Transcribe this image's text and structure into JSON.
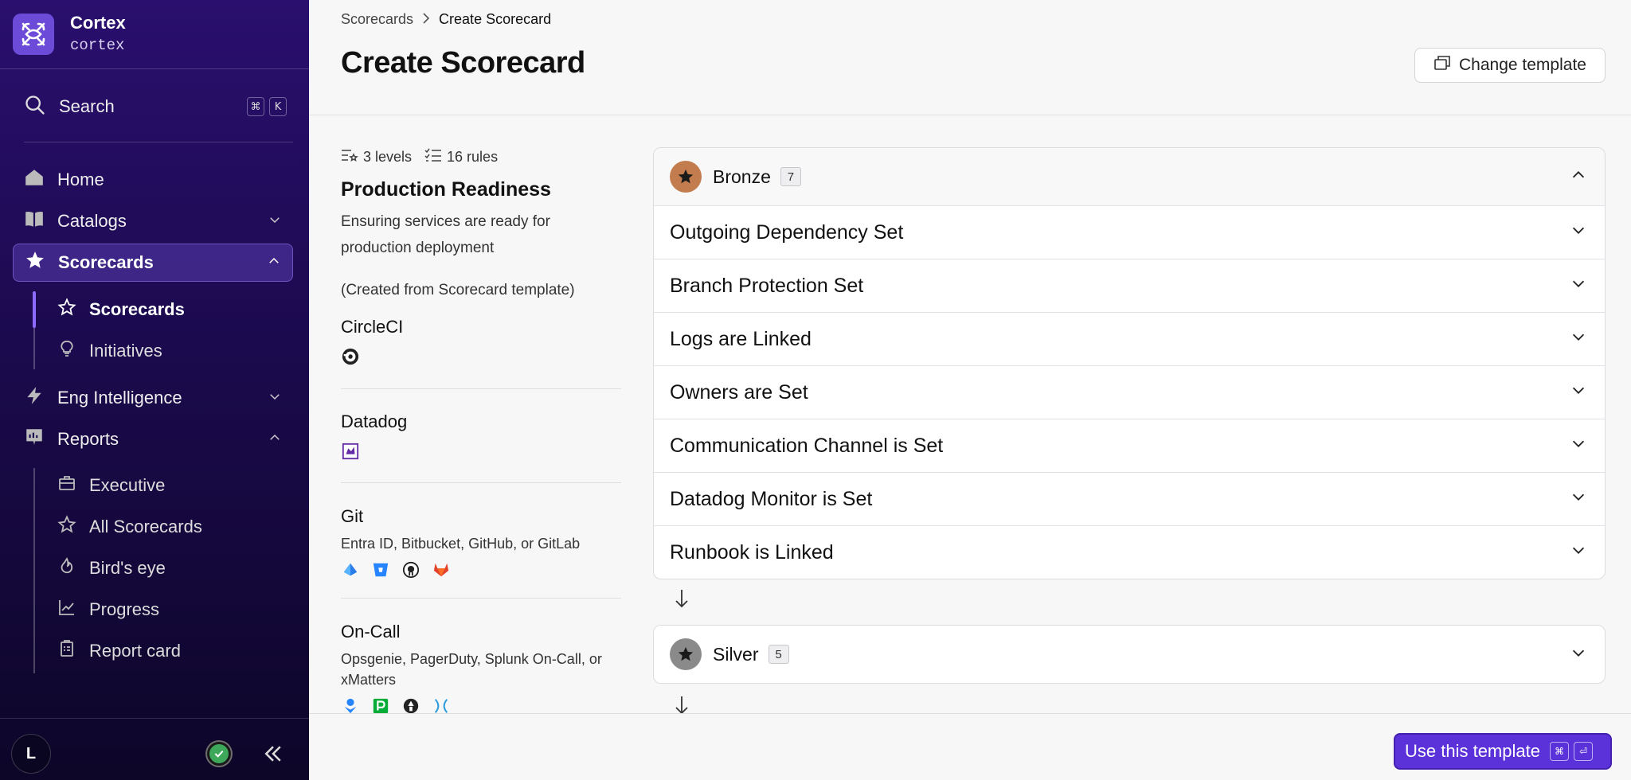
{
  "app": {
    "name": "Cortex",
    "workspace": "cortex"
  },
  "search": {
    "label": "Search",
    "shortcut": [
      "⌘",
      "K"
    ]
  },
  "nav": {
    "home": "Home",
    "catalogs": "Catalogs",
    "scorecards": "Scorecards",
    "scorecards_sub": [
      "Scorecards",
      "Initiatives"
    ],
    "eng_intelligence": "Eng Intelligence",
    "reports": "Reports",
    "reports_sub": [
      "Executive",
      "All Scorecards",
      "Bird's eye",
      "Progress",
      "Report card"
    ]
  },
  "user": {
    "initial": "L"
  },
  "breadcrumb": {
    "parent": "Scorecards",
    "current": "Create Scorecard"
  },
  "page": {
    "title": "Create Scorecard",
    "change_template": "Change template"
  },
  "scorecard": {
    "levels_count": "3 levels",
    "rules_count": "16 rules",
    "title": "Production Readiness",
    "description": "Ensuring services are ready for production deployment",
    "note": "(Created from Scorecard template)"
  },
  "integrations": [
    {
      "name": "CircleCI",
      "description": "",
      "icons": [
        "circleci-icon"
      ]
    },
    {
      "name": "Datadog",
      "description": "",
      "icons": [
        "datadog-icon"
      ]
    },
    {
      "name": "Git",
      "description": "Entra ID, Bitbucket, GitHub, or GitLab",
      "icons": [
        "entra-id-icon",
        "bitbucket-icon",
        "github-icon",
        "gitlab-icon"
      ]
    },
    {
      "name": "On-Call",
      "description": "Opsgenie, PagerDuty, Splunk On-Call, or xMatters",
      "icons": [
        "opsgenie-icon",
        "pagerduty-icon",
        "splunk-oncall-icon",
        "xmatters-icon"
      ]
    }
  ],
  "levels": [
    {
      "name": "Bronze",
      "count": "7",
      "color": "#c27c4e",
      "expanded": true,
      "rules": [
        "Outgoing Dependency Set",
        "Branch Protection Set",
        "Logs are Linked",
        "Owners are Set",
        "Communication Channel is Set",
        "Datadog Monitor is Set",
        "Runbook is Linked"
      ]
    },
    {
      "name": "Silver",
      "count": "5",
      "color": "#8a8a8a",
      "expanded": false,
      "rules": []
    }
  ],
  "footer": {
    "primary_button": "Use this template",
    "shortcut": [
      "⌘",
      "⏎"
    ]
  },
  "colors": {
    "sidebar": "#2a0f6e",
    "accent": "#5b31d9",
    "bronze": "#c27c4e",
    "silver": "#8a8a8a",
    "status_ok": "#3ea85a"
  }
}
